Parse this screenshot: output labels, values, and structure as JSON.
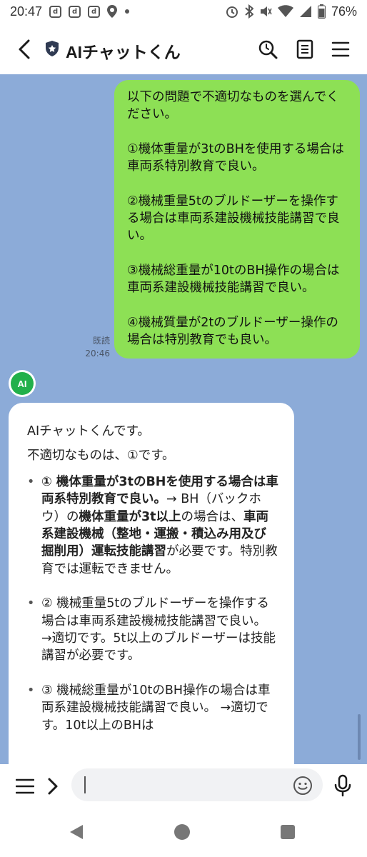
{
  "status_bar": {
    "time": "20:47",
    "battery_text": "76%",
    "notification_icons": [
      "d",
      "d",
      "d"
    ]
  },
  "header": {
    "title": "AIチャットくん",
    "icons": [
      "back-icon",
      "shield-icon",
      "search-icon",
      "notes-icon",
      "menu-icon"
    ]
  },
  "chat": {
    "user_message": {
      "paragraphs": [
        "以下の問題で不適切なものを選んでください。",
        "①機体重量が3tのBHを使用する場合は車両系特別教育で良い。",
        "②機械重量5tのブルドーザーを操作する場合は車両系建設機械技能講習で良い。",
        "③機械総重量が10tのBH操作の場合は車両系建設機械技能講習で良い。",
        "④機械質量が2tのブルドーザー操作の場合は特別教育でも良い。"
      ],
      "read_label": "既読",
      "time": "20:46"
    },
    "ai_avatar_label": "AI",
    "ai_message": {
      "intro": "AIチャットくんです。",
      "answer": "不適切なものは、①です。",
      "item1_bold_a": "① 機体重量が3tのBHを使用する場合は車両系特別教育で良い。",
      "item1_text_a": "→ BH（バックホウ）の",
      "item1_bold_b": "機体重量が3t以上",
      "item1_text_b": "の場合は、",
      "item1_bold_c": "車両系建設機械（整地・運搬・積込み用及び掘削用）運転技能講習",
      "item1_text_c": "が必要です。特別教育では運転できません。",
      "item2": "② 機械重量5tのブルドーザーを操作する場合は車両系建設機械技能講習で良い。 →適切です。5t以上のブルドーザーは技能講習が必要です。",
      "item3": "③ 機械総重量が10tのBH操作の場合は車両系建設機械技能講習で良い。 →適切です。10t以上のBHは"
    }
  },
  "input_bar": {
    "placeholder": "",
    "value": ""
  },
  "colors": {
    "chat_background": "#8CABD8",
    "user_bubble": "#8DE055",
    "ai_avatar": "#22B04B"
  }
}
